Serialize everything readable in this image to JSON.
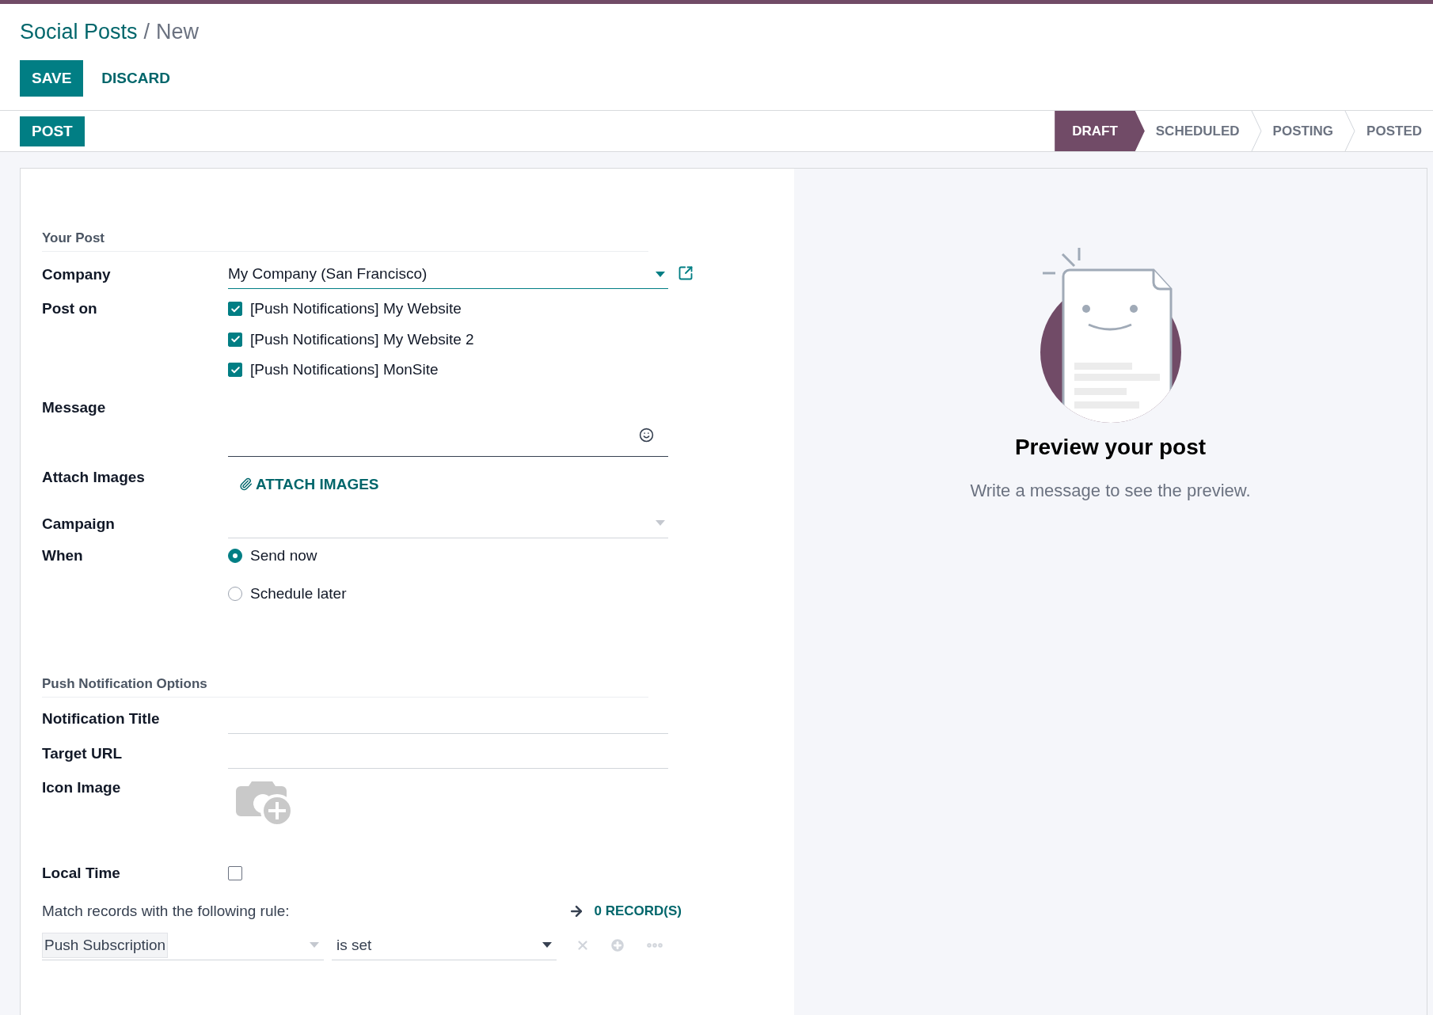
{
  "breadcrumb": {
    "parent": "Social Posts",
    "separator": "/",
    "current": "New"
  },
  "actions": [
    {
      "label": "SAVE",
      "kind": "primary"
    },
    {
      "label": "DISCARD",
      "kind": "link"
    }
  ],
  "status_bar": {
    "button": "POST",
    "stages": [
      {
        "label": "DRAFT",
        "selected": true
      },
      {
        "label": "SCHEDULED",
        "selected": false
      },
      {
        "label": "POSTING",
        "selected": false
      },
      {
        "label": "POSTED",
        "selected": false
      }
    ]
  },
  "sections": [
    {
      "title": "Your Post",
      "fields": [
        {
          "label": "Company",
          "kind": "select",
          "value": "My Company (San Francisco)",
          "focused": true,
          "external_link": true
        },
        {
          "label": "Post on",
          "kind": "checklist",
          "options": [
            {
              "label": "[Push Notifications] My Website",
              "checked": true
            },
            {
              "label": "[Push Notifications] My Website 2",
              "checked": true
            },
            {
              "label": "[Push Notifications] MonSite",
              "checked": true
            }
          ]
        },
        {
          "label": "Message",
          "kind": "textarea"
        },
        {
          "label": "Attach Images",
          "kind": "attach",
          "button": "ATTACH IMAGES"
        },
        {
          "label": "Campaign",
          "kind": "select",
          "focused": false,
          "external_link": false
        },
        {
          "label": "When",
          "kind": "radios",
          "options": [
            {
              "label": "Send now",
              "selected": true
            },
            {
              "label": "Schedule later",
              "selected": false
            }
          ]
        }
      ]
    },
    {
      "title": "Push Notification Options",
      "fields": [
        {
          "label": "Notification Title",
          "kind": "text"
        },
        {
          "label": "Target URL",
          "kind": "text"
        },
        {
          "label": "Icon Image",
          "kind": "image"
        },
        {
          "label": "Local Time",
          "kind": "checkbox",
          "checked": false
        }
      ]
    }
  ],
  "rule": {
    "intro": "Match records with the following rule:",
    "count": "0 RECORD(S)",
    "field": "Push Subscription",
    "operator": "is set"
  },
  "preview": {
    "title": "Preview your post",
    "text": "Write a message to see the preview."
  }
}
